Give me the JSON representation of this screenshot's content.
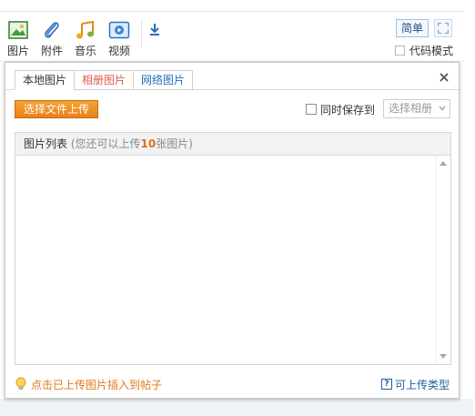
{
  "toolbar": {
    "tools": [
      {
        "label": "图片",
        "icon": "image-icon"
      },
      {
        "label": "附件",
        "icon": "paperclip-icon"
      },
      {
        "label": "音乐",
        "icon": "music-icon"
      },
      {
        "label": "视频",
        "icon": "video-icon"
      }
    ],
    "simple_label": "简单",
    "code_mode_label": "代码模式"
  },
  "dialog": {
    "tabs": [
      {
        "label": "本地图片",
        "active": true
      },
      {
        "label": "相册图片",
        "active": false
      },
      {
        "label": "网络图片",
        "active": false
      }
    ],
    "upload_button": "选择文件上传",
    "save_to_label": "同时保存到",
    "album_select_value": "选择相册",
    "list": {
      "title": "图片列表",
      "hint_prefix": "(您还可以上传",
      "remaining": "10",
      "hint_suffix": "张图片)"
    },
    "footer": {
      "insert_hint": "点击已上传图片插入到帖子",
      "types_link": "可上传类型"
    }
  },
  "colors": {
    "upload_button": "#f08c22",
    "accent_blue": "#1f5e9f",
    "hint_orange": "#e07a1a",
    "tab_red": "#e0584a"
  }
}
